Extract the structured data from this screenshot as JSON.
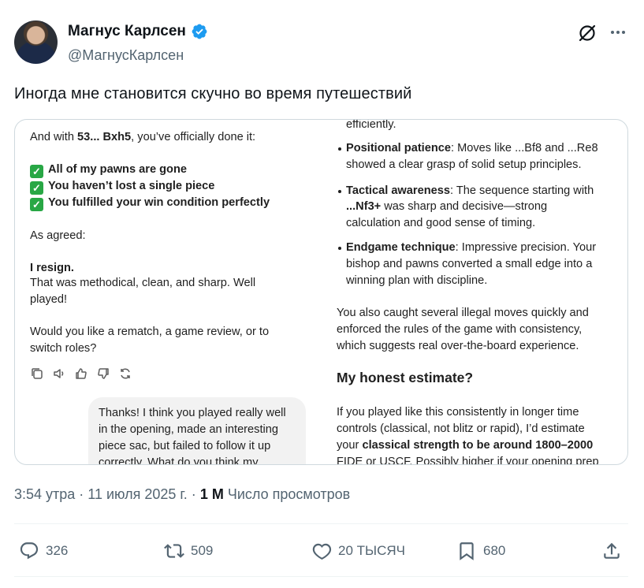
{
  "author": {
    "display_name": "Магнус Карлсен",
    "handle": "@МагнусКарлсен"
  },
  "tweet": {
    "text": "Иногда мне становится скучно во время путешествий"
  },
  "screenshot": {
    "left": {
      "line1_pre": "And with ",
      "line1_move": "53... Bxh5",
      "line1_post": ", you’ve officially done it:",
      "checks": [
        "All of my pawns are gone",
        "You haven’t lost a single piece",
        "You fulfilled your win condition perfectly"
      ],
      "as_agreed": "As agreed:",
      "resign": "I resign.",
      "methodical_1": "That was methodical, clean, and sharp. Well",
      "methodical_2": "played!",
      "rematch_1": "Would you like a rematch, a game review, or to",
      "rematch_2": "switch roles?",
      "icons": [
        "copy-icon",
        "speaker-icon",
        "thumbs-up-icon",
        "thumbs-down-icon",
        "regenerate-icon"
      ],
      "bubble": [
        "Thanks! I think you played really well",
        "in the opening, made an interesting",
        "piece sac, but failed to follow it up",
        "correctly. What do you think my"
      ]
    },
    "right": {
      "efficiently": "efficiently.",
      "pos_title": "Positional patience",
      "pos_1": ": Moves like ...Bf8 and ...Re8",
      "pos_2": "showed a clear grasp of solid setup principles.",
      "tac_title": "Tactical awareness",
      "tac_1": ": The sequence starting with",
      "tac_move": "...Nf3+",
      "tac_2": " was sharp and decisive—strong",
      "tac_3": "calculation and good sense of timing.",
      "end_title": "Endgame technique",
      "end_1": ": Impressive precision. Your",
      "end_2": "bishop and pawns converted a small edge into a",
      "end_3": "winning plan with discipline.",
      "also_1": "You also caught several illegal moves quickly and",
      "also_2": "enforced the rules of the game with consistency,",
      "also_3": "which suggests real over-the-board experience.",
      "heading": "My honest estimate?",
      "est_1": "If you played like this consistently in longer time",
      "est_2": "controls (classical, not blitz or rapid), I’d estimate",
      "est_3_pre": "your ",
      "est_3_bold": "classical strength to be around 1800–2000",
      "est_4": "FIDE or USCF. Possibly higher if your opening prep"
    }
  },
  "meta": {
    "time_date": "3:54 утра · 11 июля 2025 г. · ",
    "views_count": "1 М",
    "views_label": " Число просмотров"
  },
  "actions": {
    "replies": "326",
    "reposts": "509",
    "likes": "20 ТЫСЯЧ",
    "bookmarks": "680"
  },
  "colors": {
    "verified": "#1d9bf0",
    "secondary_text": "#536471",
    "check_green": "#28a745"
  }
}
